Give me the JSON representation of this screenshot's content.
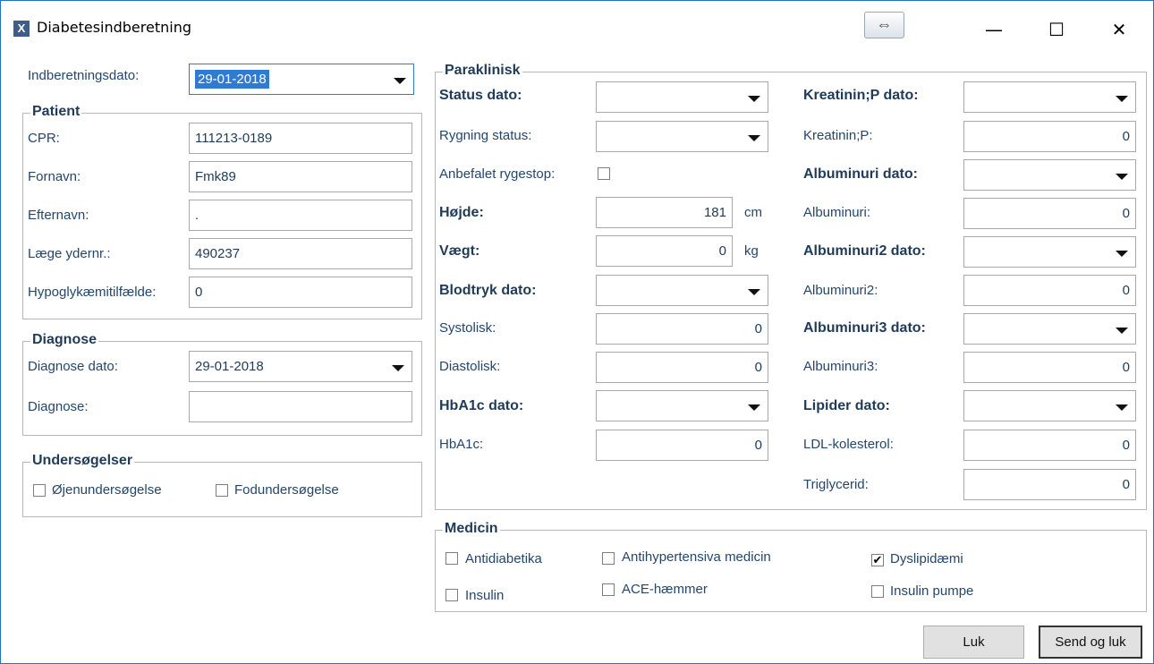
{
  "window": {
    "title": "Diabetesindberetning",
    "app_icon": "X",
    "resize_glyph": "⇔",
    "minimize_glyph": "—",
    "maximize_glyph": "☐",
    "close_glyph": "✕"
  },
  "top": {
    "date_label": "Indberetningsdato:",
    "date_value": "29-01-2018"
  },
  "patient": {
    "title": "Patient",
    "cpr_label": "CPR:",
    "cpr_value": "111213-0189",
    "fornavn_label": "Fornavn:",
    "fornavn_value": "Fmk89",
    "efternavn_label": "Efternavn:",
    "efternavn_value": ".",
    "laege_label": "Læge ydernr.:",
    "laege_value": "490237",
    "hypo_label": "Hypoglykæmitilfælde:",
    "hypo_value": "0"
  },
  "diagnose": {
    "title": "Diagnose",
    "dato_label": "Diagnose dato:",
    "dato_value": "29-01-2018",
    "diagnose_label": "Diagnose:",
    "diagnose_value": ""
  },
  "undersoegelser": {
    "title": "Undersøgelser",
    "oejen_label": "Øjenundersøgelse",
    "oejen_checked": false,
    "fod_label": "Fodundersøgelse",
    "fod_checked": false
  },
  "paraklinisk": {
    "title": "Paraklinisk",
    "status_dato_label": "Status dato:",
    "status_dato_value": "",
    "rygning_label": "Rygning status:",
    "rygning_value": "",
    "rygestop_label": "Anbefalet rygestop:",
    "rygestop_checked": false,
    "hoejde_label": "Højde:",
    "hoejde_value": "181",
    "hoejde_unit": "cm",
    "vaegt_label": "Vægt:",
    "vaegt_value": "0",
    "vaegt_unit": "kg",
    "blodtryk_label": "Blodtryk dato:",
    "blodtryk_value": "",
    "systolisk_label": "Systolisk:",
    "systolisk_value": "0",
    "diastolisk_label": "Diastolisk:",
    "diastolisk_value": "0",
    "hba1c_dato_label": "HbA1c dato:",
    "hba1c_dato_value": "",
    "hba1c_label": "HbA1c:",
    "hba1c_value": "0",
    "kreatinin_dato_label": "Kreatinin;P dato:",
    "kreatinin_dato_value": "",
    "kreatinin_label": "Kreatinin;P:",
    "kreatinin_value": "0",
    "alb_dato_label": "Albuminuri dato:",
    "alb_dato_value": "",
    "alb_label": "Albuminuri:",
    "alb_value": "0",
    "alb2_dato_label": "Albuminuri2 dato:",
    "alb2_dato_value": "",
    "alb2_label": "Albuminuri2:",
    "alb2_value": "0",
    "alb3_dato_label": "Albuminuri3 dato:",
    "alb3_dato_value": "",
    "alb3_label": "Albuminuri3:",
    "alb3_value": "0",
    "lipider_dato_label": "Lipider dato:",
    "lipider_dato_value": "",
    "ldl_label": "LDL-kolesterol:",
    "ldl_value": "0",
    "trig_label": "Triglycerid:",
    "trig_value": "0"
  },
  "medicin": {
    "title": "Medicin",
    "antidiabetika_label": "Antidiabetika",
    "antidiabetika_checked": false,
    "insulin_label": "Insulin",
    "insulin_checked": false,
    "antihyp_label": "Antihypertensiva medicin",
    "antihyp_checked": false,
    "ace_label": "ACE-hæmmer",
    "ace_checked": false,
    "dyslip_label": "Dyslipidæmi",
    "dyslip_checked": true,
    "pumpe_label": "Insulin pumpe",
    "pumpe_checked": false
  },
  "buttons": {
    "luk_label": "Luk",
    "send_label": "Send og luk"
  },
  "check_glyph": "✔",
  "colors": {
    "accent": "#2f7bd1",
    "label": "#1f3b57",
    "window_border": "#1e73c8"
  }
}
